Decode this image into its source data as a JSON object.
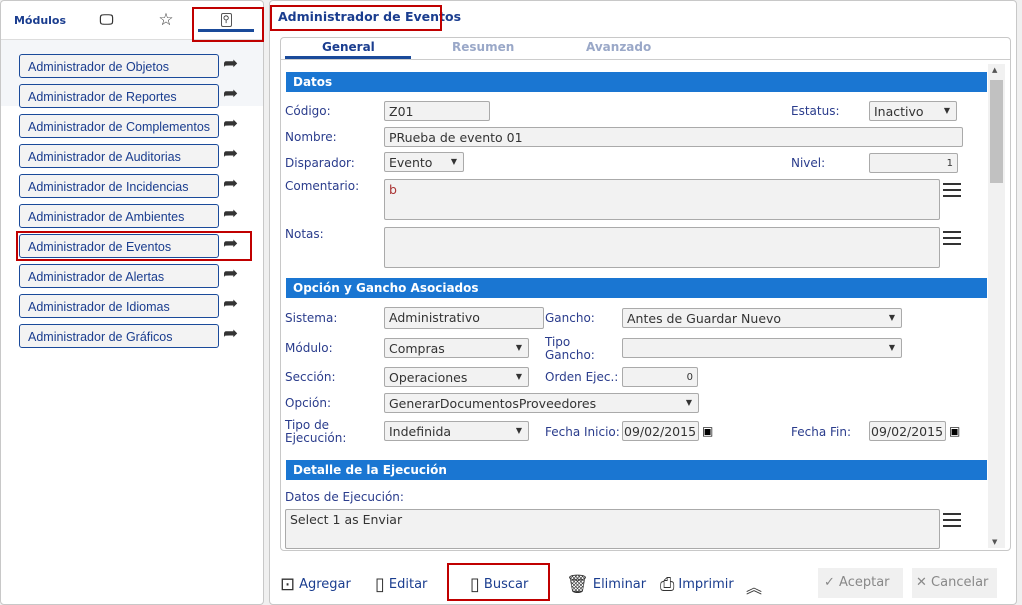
{
  "sidebar": {
    "tabs": {
      "modules": "Módulos"
    },
    "tab_icons": [
      "monitor-icon",
      "star-icon",
      "wrench-icon"
    ],
    "items": [
      "Administrador de Objetos",
      "Administrador de Reportes",
      "Administrador de Complementos",
      "Administrador de Auditorias",
      "Administrador de Incidencias",
      "Administrador de Ambientes",
      "Administrador de Eventos",
      "Administrador de Alertas",
      "Administrador de Idiomas",
      "Administrador de Gráficos"
    ],
    "selected": "Administrador de Eventos"
  },
  "form": {
    "title": "Administrador de Eventos",
    "tabs": [
      "General",
      "Resumen",
      "Avanzado"
    ],
    "active_tab": "General",
    "sections": {
      "datos": "Datos",
      "opcion": "Opción y Gancho Asociados",
      "detalle": "Detalle de la Ejecución"
    },
    "labels": {
      "codigo": "Código:",
      "estatus": "Estatus:",
      "nombre": "Nombre:",
      "disparador": "Disparador:",
      "nivel": "Nivel:",
      "comentario": "Comentario:",
      "notas": "Notas:",
      "sistema": "Sistema:",
      "gancho": "Gancho:",
      "modulo": "Módulo:",
      "tipo_gancho": "Tipo Gancho:",
      "seccion": "Sección:",
      "orden": "Orden Ejec.:",
      "opcion": "Opción:",
      "tipo_ejec": "Tipo de Ejecución:",
      "fecha_inicio": "Fecha Inicio:",
      "fecha_fin": "Fecha Fin:",
      "datos_ejec": "Datos de Ejecución:"
    },
    "values": {
      "codigo": "Z01",
      "estatus": "Inactivo",
      "nombre": "PRueba de evento 01",
      "disparador": "Evento",
      "nivel": "1",
      "comentario": "b",
      "notas": "",
      "sistema": "Administrativo",
      "gancho": "Antes de Guardar Nuevo",
      "modulo": "Compras",
      "tipo_gancho": "",
      "seccion": "Operaciones",
      "orden": "0",
      "opcion": "GenerarDocumentosProveedores",
      "tipo_ejec": "Indefinida",
      "fecha_inicio": "09/02/2015",
      "fecha_fin": "09/02/2015",
      "datos_ejec": "Select 1 as Enviar"
    }
  },
  "toolbar": {
    "agregar": "Agregar",
    "editar": "Editar",
    "buscar": "Buscar",
    "eliminar": "Eliminar",
    "imprimir": "Imprimir",
    "aceptar": "Aceptar",
    "cancelar": "Cancelar"
  },
  "colors": {
    "accent": "#1a76d2",
    "link": "#1a3d8f",
    "highlight": "#c00000"
  }
}
